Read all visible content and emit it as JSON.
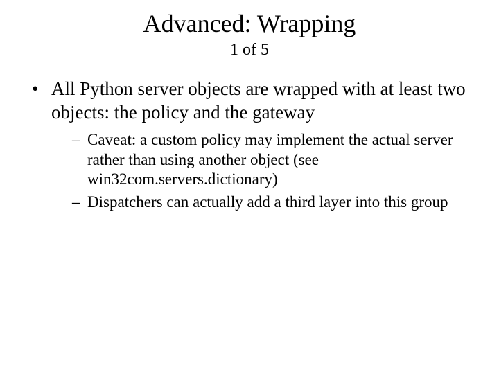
{
  "slide": {
    "title": "Advanced: Wrapping",
    "subtitle": "1 of 5",
    "bullets": [
      {
        "text": "All Python server objects are wrapped with at least two objects: the policy and the gateway",
        "sub": [
          "Caveat: a custom policy may implement the actual server rather than using another object (see win32com.servers.dictionary)",
          "Dispatchers can actually add a third layer into this group"
        ]
      }
    ]
  }
}
